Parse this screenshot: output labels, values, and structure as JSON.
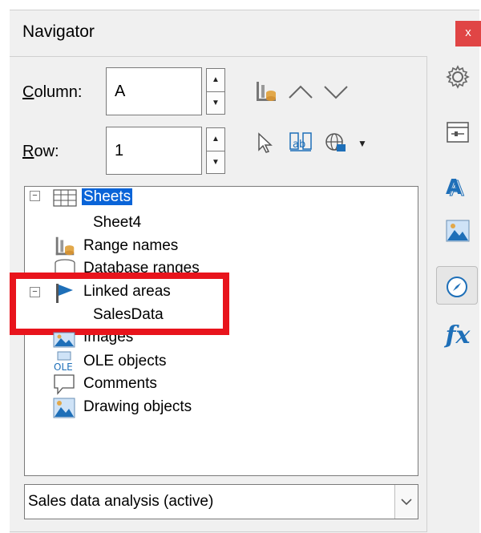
{
  "window": {
    "title": "Navigator",
    "close_label": "x"
  },
  "controls": {
    "column_label": "Column:",
    "column_mnemonic": "C",
    "column_rest": "olumn:",
    "column_value": "A",
    "row_mnemonic": "R",
    "row_rest": "ow:",
    "row_value": "1",
    "up_glyph": "▲",
    "down_glyph": "▼"
  },
  "toolbar": {
    "icons": [
      "range-names-icon",
      "previous-icon",
      "next-icon",
      "drag-mode-icon",
      "insert-as-hyperlink-icon",
      "globe-icon",
      "dropdown-arrow-icon"
    ]
  },
  "tree": {
    "expander_minus": "⊟",
    "items": [
      {
        "label": "Sheets",
        "icon": "table-icon",
        "selected": true
      },
      {
        "label": "Sheet4",
        "child": true
      },
      {
        "label": "Range names",
        "icon": "range-names-icon"
      },
      {
        "label": "Database ranges",
        "icon": "database-icon"
      },
      {
        "label": "Linked areas",
        "icon": "flag-icon"
      },
      {
        "label": "SalesData",
        "child": true
      },
      {
        "label": "Images",
        "icon": "image-icon"
      },
      {
        "label": "OLE objects",
        "icon": "ole-icon",
        "icon_text": "OLE"
      },
      {
        "label": "Comments",
        "icon": "comment-icon"
      },
      {
        "label": "Drawing objects",
        "icon": "drawing-icon"
      }
    ]
  },
  "document_select": {
    "value": "Sales data analysis (active)"
  },
  "sidebar": {
    "icons": [
      "gear-icon",
      "properties-icon",
      "styles-icon",
      "gallery-icon",
      "navigator-icon",
      "functions-icon"
    ],
    "functions_label": "fx"
  },
  "colors": {
    "accent": "#0a64d8",
    "highlight": "#e8141c",
    "close": "#e04545"
  }
}
